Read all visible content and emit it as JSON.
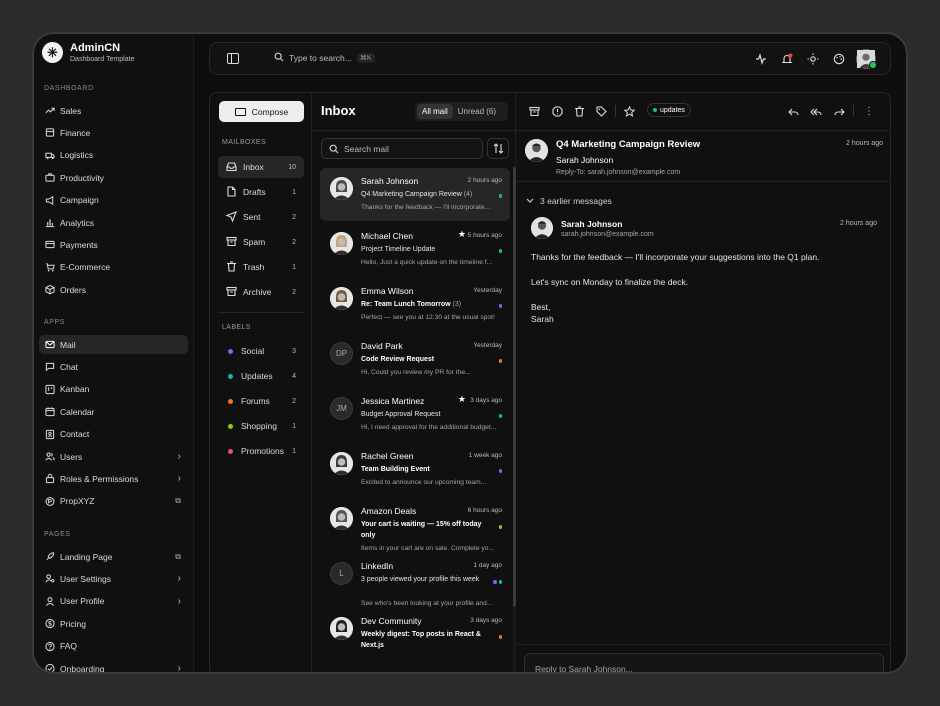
{
  "brand": {
    "name": "AdminCN",
    "subtitle": "Dashboard Template"
  },
  "sidebar": {
    "dashboard_label": "DASHBOARD",
    "dashboard_items": [
      {
        "label": "Sales",
        "icon": "trending-icon"
      },
      {
        "label": "Finance",
        "icon": "finance-icon"
      },
      {
        "label": "Logistics",
        "icon": "truck-icon"
      },
      {
        "label": "Productivity",
        "icon": "briefcase-icon"
      },
      {
        "label": "Campaign",
        "icon": "campaign-icon"
      },
      {
        "label": "Analytics",
        "icon": "bar-chart-icon"
      },
      {
        "label": "Payments",
        "icon": "credit-card-icon"
      },
      {
        "label": "E-Commerce",
        "icon": "cart-icon"
      },
      {
        "label": "Orders",
        "icon": "package-icon"
      }
    ],
    "apps_label": "APPS",
    "apps_items": [
      {
        "label": "Mail",
        "icon": "mail-icon"
      },
      {
        "label": "Chat",
        "icon": "chat-icon"
      },
      {
        "label": "Kanban",
        "icon": "kanban-icon"
      },
      {
        "label": "Calendar",
        "icon": "calendar-icon"
      },
      {
        "label": "Contact",
        "icon": "contact-icon"
      },
      {
        "label": "Users",
        "icon": "users-icon"
      },
      {
        "label": "Roles & Permissions",
        "icon": "lock-icon"
      },
      {
        "label": "PropXYZ",
        "icon": "propxyz-icon"
      }
    ],
    "pages_label": "PAGES",
    "pages_items": [
      {
        "label": "Landing Page",
        "icon": "rocket-icon"
      },
      {
        "label": "User Settings",
        "icon": "user-settings-icon"
      },
      {
        "label": "User Profile",
        "icon": "user-icon"
      },
      {
        "label": "Pricing",
        "icon": "dollar-icon"
      },
      {
        "label": "FAQ",
        "icon": "help-icon"
      },
      {
        "label": "Onboarding",
        "icon": "onboarding-icon"
      }
    ]
  },
  "topbar": {
    "search_placeholder": "Type to search...",
    "shortcut": "⌘K"
  },
  "mail": {
    "compose_label": "Compose",
    "mailboxes_label": "MAILBOXES",
    "mailboxes": [
      {
        "label": "Inbox",
        "count": "10",
        "icon": "inbox-icon"
      },
      {
        "label": "Drafts",
        "count": "1",
        "icon": "file-icon"
      },
      {
        "label": "Sent",
        "count": "2",
        "icon": "send-icon"
      },
      {
        "label": "Spam",
        "count": "2",
        "icon": "spam-icon"
      },
      {
        "label": "Trash",
        "count": "1",
        "icon": "trash-icon"
      },
      {
        "label": "Archive",
        "count": "2",
        "icon": "archive-icon"
      }
    ],
    "labels_label": "LABELS",
    "labels": [
      {
        "label": "Social",
        "count": "3",
        "color": "#8b5cf6"
      },
      {
        "label": "Updates",
        "count": "4",
        "color": "#14b8a6"
      },
      {
        "label": "Forums",
        "count": "2",
        "color": "#f97316"
      },
      {
        "label": "Shopping",
        "count": "1",
        "color": "#84cc16"
      },
      {
        "label": "Promotions",
        "count": "1",
        "color": "#ec4899"
      }
    ],
    "inbox_title": "Inbox",
    "tab_all": "All mail",
    "tab_unread": "Unread (6)",
    "search_placeholder": "Search mail",
    "messages": [
      {
        "name": "Sarah Johnson",
        "time": "2 hours ago",
        "subject": "Q4 Marketing Campaign Review",
        "thread": "(4)",
        "preview": "Thanks for the feedback — I'll incorporate...",
        "starred": false,
        "bold": false,
        "initials": "",
        "tags": [
          "#14b8a6"
        ]
      },
      {
        "name": "Michael Chen",
        "time": "5 hours ago",
        "subject": "Project Timeline Update",
        "thread": "",
        "preview": "Hello, Just a quick update on the timeline f...",
        "starred": true,
        "bold": false,
        "initials": "",
        "tags": [
          "#14b8a6"
        ]
      },
      {
        "name": "Emma Wilson",
        "time": "Yesterday",
        "subject": "Re: Team Lunch Tomorrow",
        "thread": "(3)",
        "preview": "Perfect — see you at 12:30 at the usual spot!",
        "starred": false,
        "bold": true,
        "initials": "",
        "tags": [
          "#8b5cf6"
        ]
      },
      {
        "name": "David Park",
        "time": "Yesterday",
        "subject": "Code Review Request",
        "thread": "",
        "preview": "Hi, Could you review my PR for the...",
        "starred": false,
        "bold": true,
        "initials": "DP",
        "tags": [
          "#f97316"
        ]
      },
      {
        "name": "Jessica Martinez",
        "time": "3 days ago",
        "subject": "Budget Approval Request",
        "thread": "",
        "preview": "Hi, I need approval for the additional budget...",
        "starred": true,
        "bold": false,
        "initials": "JM",
        "tags": [
          "#14b8a6"
        ]
      },
      {
        "name": "Rachel Green",
        "time": "1 week ago",
        "subject": "Team Building Event",
        "thread": "",
        "preview": "Excited to announce our upcoming team...",
        "starred": false,
        "bold": true,
        "initials": "",
        "tags": [
          "#8b5cf6"
        ]
      },
      {
        "name": "Amazon Deals",
        "time": "6 hours ago",
        "subject": "Your cart is waiting — 15% off today only",
        "thread": "",
        "preview": "Items in your cart are on sale. Complete yo...",
        "starred": false,
        "bold": true,
        "initials": "",
        "tags": [
          "#84cc16"
        ]
      },
      {
        "name": "LinkedIn",
        "time": "1 day ago",
        "subject": "3 people viewed your profile this week",
        "thread": "",
        "preview": "See who's been looking at your profile and...",
        "starred": false,
        "bold": false,
        "initials": "L",
        "tags": [
          "#8b5cf6",
          "#14b8a6"
        ]
      },
      {
        "name": "Dev Community",
        "time": "3 days ago",
        "subject": "Weekly digest: Top posts in React & Next.js",
        "thread": "",
        "preview": "",
        "starred": false,
        "bold": true,
        "initials": "",
        "tags": [
          "#f97316"
        ]
      }
    ],
    "reader": {
      "label_chip": "updates",
      "subject": "Q4 Marketing Campaign Review",
      "from": "Sarah Johnson",
      "time": "2 hours ago",
      "reply_to": "Reply-To: sarah.johnson@example.com",
      "earlier": "3 earlier messages",
      "message": {
        "name": "Sarah Johnson",
        "email": "sarah.johnson@example.com",
        "time": "2 hours ago",
        "body": [
          "Thanks for the feedback — I'll incorporate your suggestions into the Q1 plan.",
          "Let's sync on Monday to finalize the deck.",
          "Best,",
          "Sarah"
        ]
      },
      "reply_placeholder": "Reply to Sarah Johnson..."
    }
  }
}
